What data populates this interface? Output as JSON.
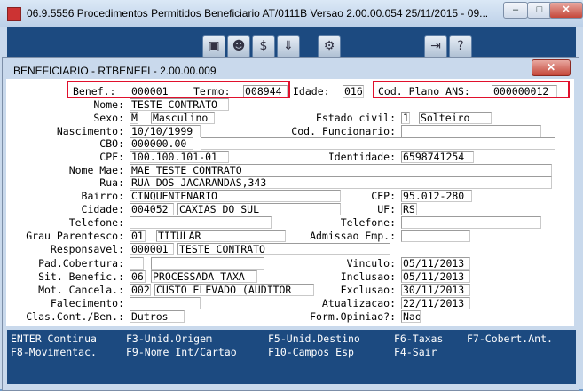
{
  "outer_window": {
    "title": "06.9.5556 Procedimentos Permitidos Beneficiario AT/0111B Versao 2.00.00.054 25/11/2015 - 09...",
    "min": "–",
    "max": "□",
    "close": "✕"
  },
  "dialog": {
    "title": "BENEFICIARIO - RTBENEFI - 2.00.00.009",
    "close": "✕"
  },
  "form": {
    "benef_label": "Benef.:",
    "benef": "000001",
    "termo_label": "Termo:",
    "termo": "008944",
    "idade_label": "Idade:",
    "idade": "016",
    "cod_plano_label": "Cod. Plano ANS:",
    "cod_plano": "000000012",
    "nome_label": "Nome:",
    "nome": "TESTE CONTRATO",
    "sexo_label": "Sexo:",
    "sexo_code": "M",
    "sexo": "Masculino",
    "estado_civil_label": "Estado civil:",
    "estado_civil_code": "1",
    "estado_civil": "Solteiro",
    "nascimento_label": "Nascimento:",
    "nascimento": "10/10/1999",
    "cod_funcionario_label": "Cod. Funcionario:",
    "cod_funcionario": "",
    "cbo_label": "CBO:",
    "cbo": "000000.00",
    "cbo_desc": "",
    "cpf_label": "CPF:",
    "cpf": "100.100.101-01",
    "identidade_label": "Identidade:",
    "identidade": "6598741254",
    "nome_mae_label": "Nome Mae:",
    "nome_mae": "MAE TESTE CONTRATO",
    "rua_label": "Rua:",
    "rua": "RUA DOS JACARANDAS,343",
    "bairro_label": "Bairro:",
    "bairro": "CINQUENTENARIO",
    "cep_label": "CEP:",
    "cep": "95.012-280",
    "cidade_label": "Cidade:",
    "cidade_code": "004052",
    "cidade": "CAXIAS DO SUL",
    "uf_label": "UF:",
    "uf": "RS",
    "telefone1_label": "Telefone:",
    "telefone1": "",
    "telefone2_label": "Telefone:",
    "telefone2": "",
    "grau_label": "Grau Parentesco:",
    "grau_code": "01",
    "grau": "TITULAR",
    "admissao_label": "Admissao Emp.:",
    "admissao": "",
    "responsavel_label": "Responsavel:",
    "responsavel_code": "000001",
    "responsavel": "TESTE CONTRATO",
    "pad_cobertura_label": "Pad.Cobertura:",
    "pad_cobertura_code": "",
    "pad_cobertura": "",
    "vinculo_label": "Vinculo:",
    "vinculo": "05/11/2013",
    "sit_benef_label": "Sit. Benefic.:",
    "sit_benef_code": "06",
    "sit_benef": "PROCESSADA TAXA",
    "inclusao_label": "Inclusao:",
    "inclusao": "05/11/2013",
    "mot_cancela_label": "Mot. Cancela.:",
    "mot_cancela_code": "002",
    "mot_cancela": "CUSTO ELEVADO (AUDITOR",
    "exclusao_label": "Exclusao:",
    "exclusao": "30/11/2013",
    "falecimento_label": "Falecimento:",
    "falecimento": "",
    "atualizacao_label": "Atualizacao:",
    "atualizacao": "22/11/2013",
    "clas_cont_label": "Clas.Cont./Ben.:",
    "clas_cont": "Dutros",
    "form_opiniao_label": "Form.Opiniao?:",
    "form_opiniao": "Nao"
  },
  "function_keys": {
    "f_enter": "ENTER Continua",
    "f3": "F3-Unid.Origem",
    "f5": "F5-Unid.Destino",
    "f6": "F6-Taxas",
    "f7": "F7-Cobert.Ant.",
    "f8": "F8-Movimentac.",
    "f9": "F9-Nome Int/Cartao",
    "f10": "F10-Campos Esp",
    "f4": "F4-Sair"
  },
  "colors": {
    "highlight": "#e0102c",
    "terminal_bg": "#1c4a80",
    "window_bg": "#c9d9ec"
  }
}
